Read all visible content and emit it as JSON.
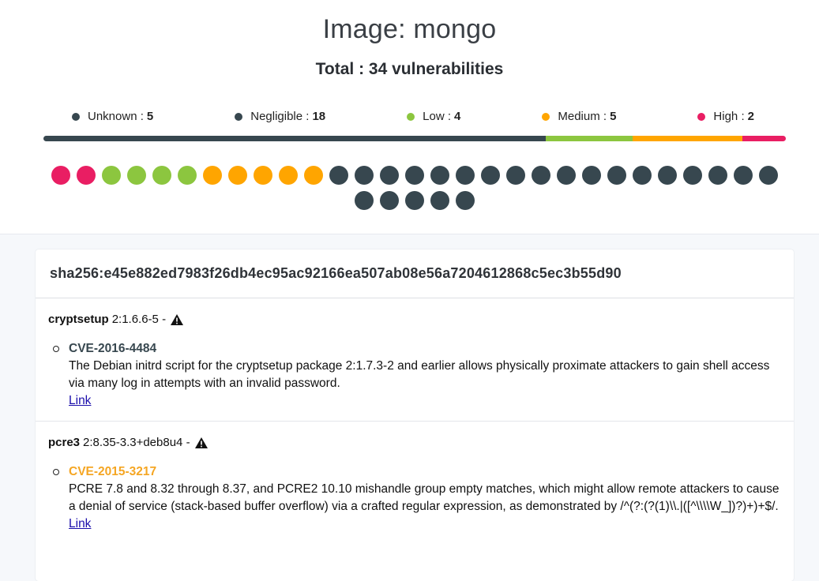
{
  "header": {
    "title": "Image: mongo",
    "total": "Total : 34 vulnerabilities"
  },
  "legend": [
    {
      "label": "Unknown :",
      "count": "5",
      "color": "#37474f"
    },
    {
      "label": "Negligible :",
      "count": "18",
      "color": "#37474f"
    },
    {
      "label": "Low :",
      "count": "4",
      "color": "#8cc63f"
    },
    {
      "label": "Medium :",
      "count": "5",
      "color": "#ffa500"
    },
    {
      "label": "High :",
      "count": "2",
      "color": "#e91e63"
    }
  ],
  "bar_segments": [
    {
      "name": "unknown-negligible",
      "count": 23,
      "color": "#37474f"
    },
    {
      "name": "low",
      "count": 4,
      "color": "#8cc63f"
    },
    {
      "name": "medium",
      "count": 5,
      "color": "#ffa500"
    },
    {
      "name": "high",
      "count": 2,
      "color": "#e91e63"
    }
  ],
  "dots": {
    "high": {
      "count": 2,
      "color": "#e91e63"
    },
    "low": {
      "count": 4,
      "color": "#8cc63f"
    },
    "medium": {
      "count": 5,
      "color": "#ffa500"
    },
    "other": {
      "count": 23,
      "color": "#37474f"
    }
  },
  "card": {
    "sha": "sha256:e45e882ed7983f26db4ec95ac92166ea507ab08e56a7204612868c5ec3b55d90",
    "packages": [
      {
        "name": "cryptsetup",
        "version": "2:1.6.6-5 -",
        "icon": "warning-icon",
        "cves": [
          {
            "id": "CVE-2016-4484",
            "color": "#37474f",
            "description": "The Debian initrd script for the cryptsetup package 2:1.7.3-2 and earlier allows physically proximate attackers to gain shell access via many log in attempts with an invalid password.",
            "link": "Link"
          }
        ]
      },
      {
        "name": "pcre3",
        "version": "2:8.35-3.3+deb8u4 -",
        "icon": "warning-icon",
        "cves": [
          {
            "id": "CVE-2015-3217",
            "color": "#f5a623",
            "description": "PCRE 7.8 and 8.32 through 8.37, and PCRE2 10.10 mishandle group empty matches, which might allow remote attackers to cause a denial of service (stack-based buffer overflow) via a crafted regular expression, as demonstrated by /^(?:(?(1)\\\\.|([^\\\\\\\\W_])?)+)+$/.",
            "link": "Link"
          }
        ]
      }
    ]
  }
}
